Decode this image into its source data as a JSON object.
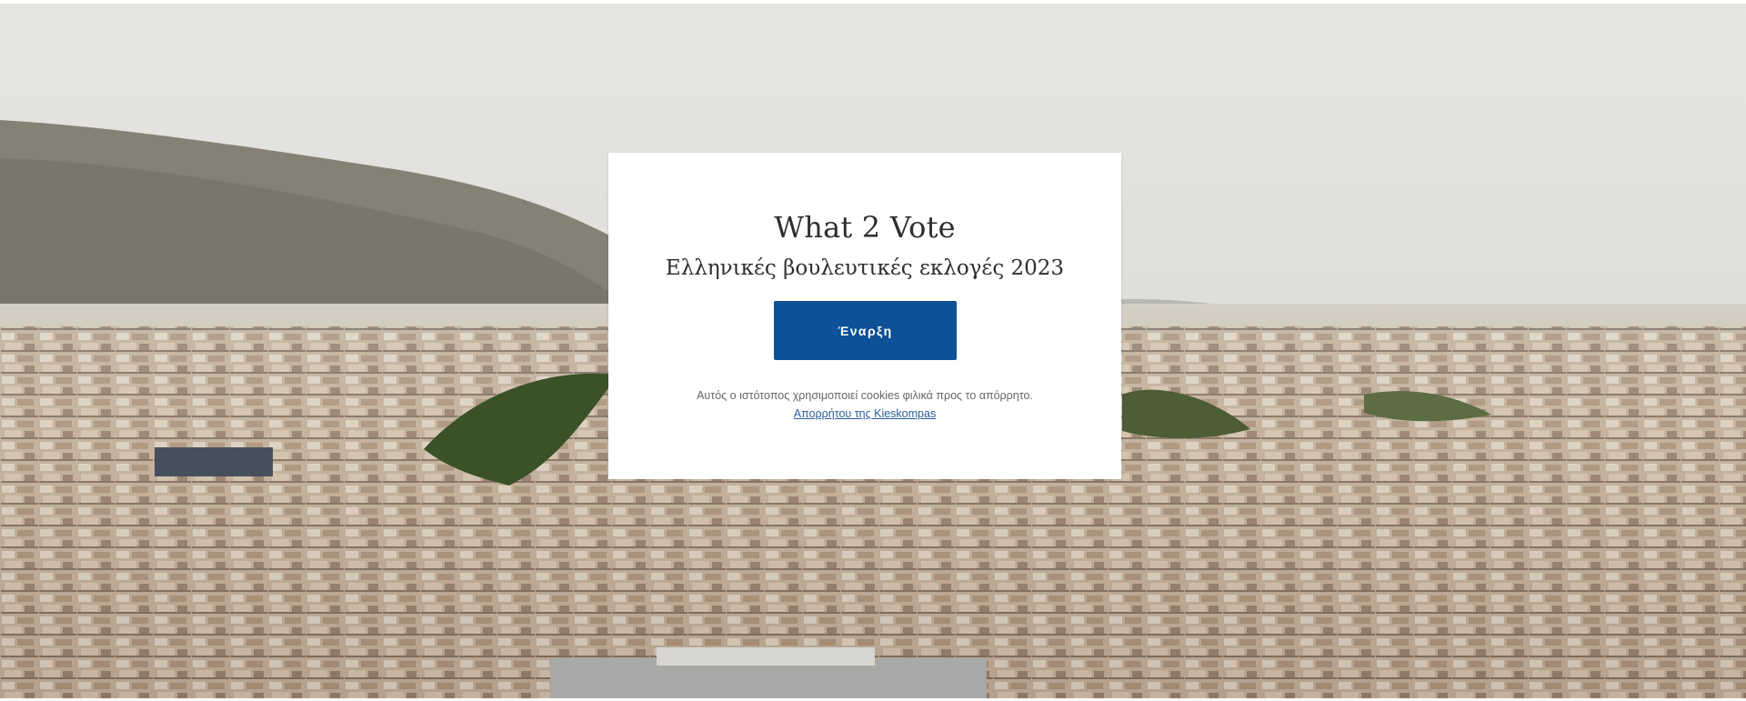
{
  "background": {
    "image": "athens-cityscape-photo",
    "sky_color": "#e3e2dd",
    "hill_color": "#8a8578",
    "city_color": "#c9b9a3"
  },
  "welcome_card": {
    "title": "What 2 Vote",
    "subtitle": "Ελληνικές βουλευτικές εκλογές 2023",
    "start_button": "Έναρξη",
    "cookie_notice": "Αυτός ο ιστότοπος χρησιμοποιεί cookies φιλικά προς το απόρρητο.",
    "privacy_link": "Απορρήτου της Kieskompas",
    "button_color": "#0d5198"
  }
}
